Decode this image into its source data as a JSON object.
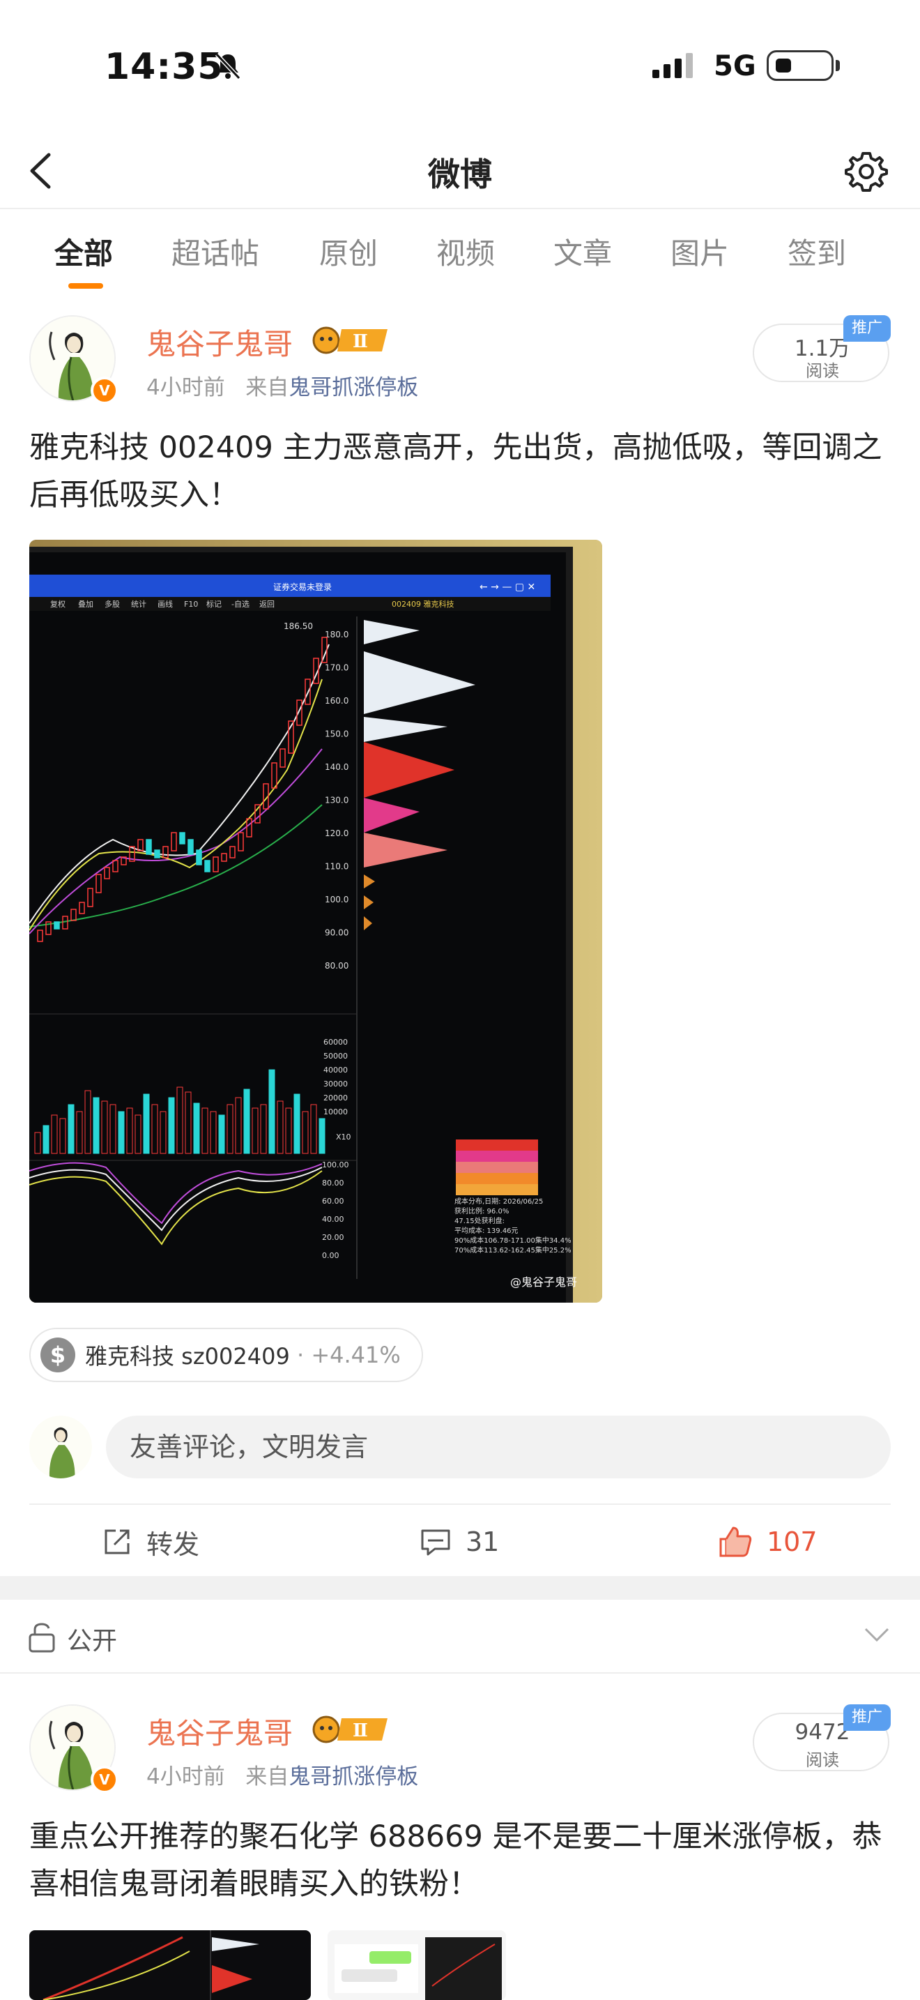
{
  "status_bar": {
    "time": "14:35",
    "network": "5G"
  },
  "nav": {
    "title": "微博"
  },
  "tabs": [
    "全部",
    "超话帖",
    "原创",
    "视频",
    "文章",
    "图片",
    "签到"
  ],
  "posts": [
    {
      "username": "鬼谷子鬼哥",
      "level": "Ⅱ",
      "time": "4小时前",
      "from_prefix": "来自",
      "source": "鬼哥抓涨停板",
      "reads": "1.1万",
      "reads_label": "阅读",
      "promo": "推广",
      "text": "雅克科技 002409 主力恶意高开，先出货，高抛低吸，等回调之后再低吸买入！",
      "stock_chip": {
        "name": "雅克科技 sz002409",
        "change": "+4.41%"
      },
      "comment_placeholder": "友善评论，文明发言",
      "actions": {
        "repost": "转发",
        "comments": "31",
        "likes": "107"
      },
      "chart_photo": {
        "window_title": "证券交易未登录",
        "menu_items": [
          "复权",
          "叠加",
          "多股",
          "统计",
          "画线",
          "F10",
          "标记",
          "-自选",
          "返回"
        ],
        "stock_title": "002409 雅克科技",
        "high_label": "186.50",
        "price_ticks": [
          "180.0",
          "170.0",
          "160.0",
          "150.0",
          "140.0",
          "130.0",
          "120.0",
          "110.0",
          "100.0",
          "90.00",
          "80.00"
        ],
        "volume_ticks": [
          "60000",
          "50000",
          "40000",
          "30000",
          "20000",
          "10000"
        ],
        "volume_unit": "X10",
        "osc_ticks": [
          "100.00",
          "80.00",
          "60.00",
          "40.00",
          "20.00",
          "0.00"
        ],
        "chip_info": [
          "成本分布,日期: 2026/06/25",
          "获利比例: 96.0%",
          "47.15处获利盘:",
          "平均成本: 139.46元",
          "90%成本106.78-171.00集中34.4%",
          "70%成本113.62-162.45集中25.2%"
        ],
        "watermark": "@鬼谷子鬼哥"
      }
    },
    {
      "username": "鬼谷子鬼哥",
      "level": "Ⅱ",
      "time": "4小时前",
      "from_prefix": "来自",
      "source": "鬼哥抓涨停板",
      "reads": "9472",
      "reads_label": "阅读",
      "promo": "推广",
      "text": "重点公开推荐的聚石化学 688669 是不是要二十厘米涨停板，恭喜相信鬼哥闭着眼睛买入的铁粉！"
    }
  ],
  "visibility": "公开",
  "colors": {
    "accent": "#ff8200",
    "username": "#eb7350",
    "like": "#e8543a",
    "source": "#5a6d9a"
  }
}
